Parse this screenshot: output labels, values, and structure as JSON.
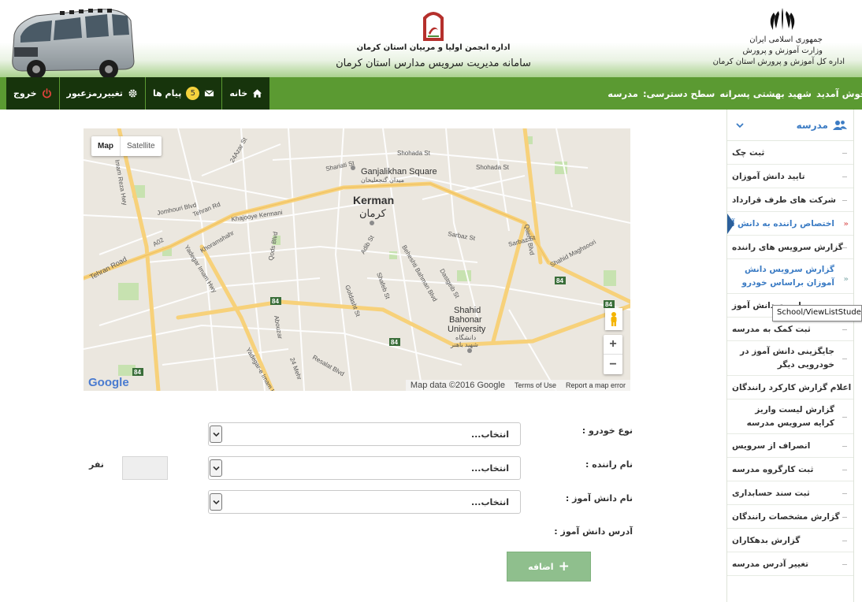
{
  "header": {
    "assoc_title": "اداره انجمن اولیا و مربیان استان کرمان",
    "system_title": "سامانه مدیریت سرویس مدارس استان کرمان",
    "right_lines": [
      "جمهوری اسلامی ایران",
      "وزارت آموزش و پرورش",
      "اداره کل آموزش و پرورش استان کرمان"
    ]
  },
  "navbar": {
    "welcome": "خوش آمدید",
    "school_name": "شهید بهشتی پسرانه",
    "access_label": "سطح دسترسی:",
    "access_value": "مدرسه",
    "home_label": "خانه",
    "messages_label": "پیام ها",
    "messages_count": "5",
    "change_password_label": "تغییررمزعبور",
    "logout_label": "خروج",
    "colors": {
      "bar": "#5b9a32",
      "buttons": "#17340c",
      "badge": "#f5d23d"
    }
  },
  "sidebar": {
    "title": "مدرسه",
    "items": [
      {
        "label": "ثبت چک"
      },
      {
        "label": "تایید دانش آموزان"
      },
      {
        "label": "شرکت های طرف قرارداد"
      },
      {
        "label": "اختصاص راننده به دانش آموز"
      },
      {
        "label": "گزارش سرویس های راننده"
      },
      {
        "label": "گزارش سرویس دانش آموزان براساس خودرو"
      },
      {
        "label": "لیست دانش آموز"
      },
      {
        "label": "ثبت کمک به مدرسه"
      },
      {
        "label": "جایگزینی دانش آموز در خودرویی دیگر"
      },
      {
        "label": "اعلام گزارش کارکرد رانندگان"
      },
      {
        "label": "گزارش لیست واریز کرایه سرویس مدرسه"
      },
      {
        "label": "انصراف از سرویس"
      },
      {
        "label": "ثبت کارگروه مدرسه"
      },
      {
        "label": "ثبت سند حسابداری"
      },
      {
        "label": "گزارش مشخصات رانندگان"
      },
      {
        "label": "گزارش بدهکاران"
      },
      {
        "label": "تغییر آدرس مدرسه"
      }
    ],
    "tooltip": "School/ViewListStudent",
    "accent": "#3c7cc4"
  },
  "map": {
    "map_label": "Map",
    "satellite_label": "Satellite",
    "city_en": "Kerman",
    "city_fa": "کرمان",
    "google": "Google",
    "footer_data": "Map data ©2016 Google",
    "footer_terms": "Terms of Use",
    "footer_report": "Report a map error",
    "labels": {
      "ganjalikhan": "Ganjalikhan Square",
      "ganjalikhan_fa": "میدان گنجعلیخان",
      "university_1": "Shahid",
      "university_2": "Bahonar",
      "university_3": "University",
      "university_fa_1": "دانشگاه",
      "university_fa_2": "شهید باهنر",
      "tehran_road": "Tehran Road",
      "tehran_rd": "Tehran Rd",
      "jomhouri": "Jomhouri Blvd",
      "imam_reza": "Imam Reza Hwy",
      "yadegar": "Yadegar Imam Hwy",
      "yadegar_2": "Yadegar-e Imam Hwy",
      "khajooye": "Khajooye Kermani",
      "khoramshahr": "Khoramshahr",
      "qods": "Qods Blvd",
      "adib": "Adib St",
      "sarbaz": "Sarbaz St",
      "sarbaz2": "Sarbaz St",
      "qaem": "Qaem Blvd",
      "shahid_maghsoori": "Shahid Maghsoori",
      "dastgeib": "Dastgeib St",
      "beheshti": "Beheshti Bahman Blvd",
      "shafeb": "Shafeb St",
      "abouzar": "Abouzar",
      "resalat": "Resalat Blvd",
      "mehr": "24 Mehr",
      "shohada": "Shohada St",
      "shohada2": "Shohada St",
      "shariati": "Shariati St",
      "goldasht": "Goldasht St",
      "azar": "24Azar St",
      "a02": "A02",
      "r84a": "84",
      "r84b": "84",
      "r84c": "84",
      "r84d": "84",
      "r84e": "84"
    }
  },
  "form": {
    "vehicle_label": "نوع خودرو :",
    "vehicle_value": "انتخاب...",
    "driver_label": "نام راننده :",
    "driver_value": "انتخاب...",
    "student_label": "نام دانش آموز :",
    "student_value": "انتخاب...",
    "address_label": "آدرس دانش آموز :",
    "count_unit": "نفر",
    "add_label": "اضافه"
  }
}
